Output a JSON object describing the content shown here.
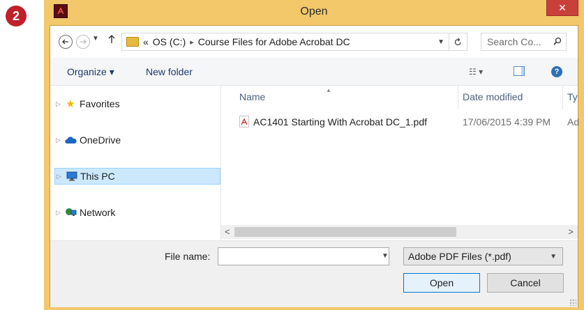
{
  "step_badge": "2",
  "window": {
    "title": "Open",
    "close_glyph": "✕"
  },
  "address": {
    "back_icon": "back-arrow-icon",
    "forward_icon": "forward-arrow-icon",
    "overflow": "«",
    "crumbs": [
      "OS (C:)",
      "Course Files for Adobe Acrobat DC"
    ],
    "separator": "▸",
    "search_placeholder": "Search Co..."
  },
  "toolbar": {
    "organize_label": "Organize ▾",
    "new_folder_label": "New folder"
  },
  "nav": {
    "items": [
      {
        "label": "Favorites",
        "icon": "star-icon",
        "selected": false
      },
      {
        "label": "OneDrive",
        "icon": "cloud-icon",
        "selected": false
      },
      {
        "label": "This PC",
        "icon": "computer-icon",
        "selected": true
      },
      {
        "label": "Network",
        "icon": "network-icon",
        "selected": false
      }
    ]
  },
  "files": {
    "columns": [
      "Name",
      "Date modified",
      "Ty"
    ],
    "rows": [
      {
        "name": "AC1401 Starting With Acrobat DC_1.pdf",
        "date": "17/06/2015 4:39 PM",
        "type": "Ad",
        "icon": "pdf-icon"
      }
    ]
  },
  "bottom": {
    "file_name_label": "File name:",
    "file_name_value": "",
    "file_type_value": "Adobe PDF Files (*.pdf)",
    "open_label": "Open",
    "cancel_label": "Cancel"
  },
  "colors": {
    "accent": "#0078d7",
    "selection": "#cce8ff",
    "frame": "#f2c86a",
    "close": "#c9403a",
    "badge": "#c0202a"
  }
}
